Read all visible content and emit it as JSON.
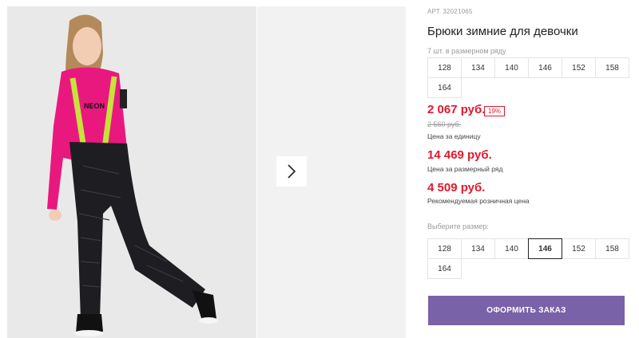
{
  "product": {
    "sku_label": "АРТ.",
    "sku": "32021065",
    "title": "Брюки зимние для девочки",
    "row_note": "7 шт. в размерном ряду",
    "row_sizes": [
      "128",
      "134",
      "140",
      "146",
      "152",
      "158",
      "164"
    ],
    "price": "2 067 руб.",
    "discount": "19%",
    "old_price": "2 560 руб.",
    "price_caption": "Цена за единицу",
    "row_price": "14 469 руб.",
    "row_price_caption": "Цена за размерный ряд",
    "rec_price": "4 509 руб.",
    "rec_price_caption": "Рекомендуемая розничная цена",
    "choose_label": "Выберите размер:",
    "pick_sizes": [
      "128",
      "134",
      "140",
      "146",
      "152",
      "158",
      "164"
    ],
    "selected_size": "146",
    "order_label": "ОФОРМИТЬ ЗАКАЗ"
  },
  "colors": {
    "price": "#e2192e",
    "accent": "#7a62a8"
  }
}
